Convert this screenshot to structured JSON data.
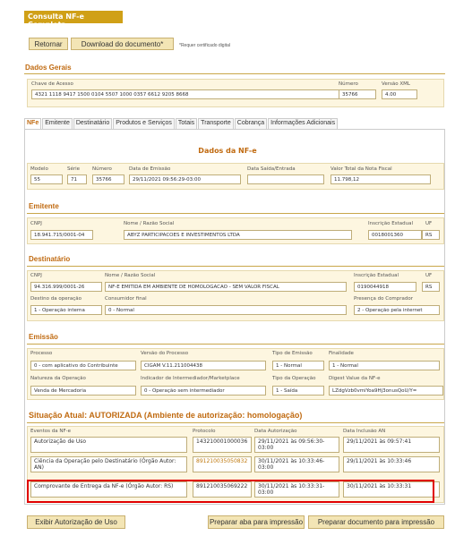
{
  "header": {
    "title": "Consulta NF-e Completa"
  },
  "actions": {
    "retornar": "Retornar",
    "download": "Download do documento*",
    "note": "*Requer certificado digital"
  },
  "dados_gerais": {
    "title": "Dados Gerais",
    "chave_label": "Chave de Acesso",
    "chave": "4321 1118 9417 1500 0104 5507 1000 0357 6612 9205 8668",
    "numero_label": "Número",
    "numero": "35766",
    "versao_label": "Versão XML",
    "versao": "4.00"
  },
  "tabs": [
    "NFe",
    "Emitente",
    "Destinatário",
    "Produtos e Serviços",
    "Totais",
    "Transporte",
    "Cobrança",
    "Informações Adicionais"
  ],
  "nfe": {
    "title": "Dados da NF-e",
    "modelo_label": "Modelo",
    "modelo": "55",
    "serie_label": "Série",
    "serie": "71",
    "numero_label": "Número",
    "numero": "35766",
    "emissao_label": "Data de Emissão",
    "emissao": "29/11/2021 09:56:29-03:00",
    "saida_label": "Data Saída/Entrada",
    "saida": "",
    "total_label": "Valor Total da Nota Fiscal",
    "total": "11.798,12"
  },
  "emitente": {
    "title": "Emitente",
    "cnpj_label": "CNPJ",
    "cnpj": "18.941.715/0001-04",
    "nome_label": "Nome / Razão Social",
    "nome": "ABYZ PARTICIPACOES E INVESTIMENTOS LTDA",
    "ie_label": "Inscrição Estadual",
    "ie": "0018001360",
    "uf_label": "UF",
    "uf": "RS"
  },
  "destinatario": {
    "title": "Destinatário",
    "cnpj_label": "CNPJ",
    "cnpj": "94.316.999/0001-26",
    "nome_label": "Nome / Razão Social",
    "nome": "NF-E EMITIDA EM AMBIENTE DE HOMOLOGACAO - SEM VALOR FISCAL",
    "ie_label": "Inscrição Estadual",
    "ie": "0190044918",
    "uf_label": "UF",
    "uf": "RS",
    "destino_label": "Destino da operação",
    "destino": "1 - Operação interna",
    "consumidor_label": "Consumidor final",
    "consumidor": "0 - Normal",
    "presenca_label": "Presença do Comprador",
    "presenca": "2 - Operação pela internet"
  },
  "emissao": {
    "title": "Emissão",
    "processo_label": "Processo",
    "processo": "0 - com aplicativo do Contribuinte",
    "versao_label": "Versão do Processo",
    "versao": "CIGAM V.11.211004438",
    "tipo_label": "Tipo de Emissão",
    "tipo": "1 - Normal",
    "finalidade_label": "Finalidade",
    "finalidade": "1 - Normal",
    "natureza_label": "Natureza da Operação",
    "natureza": "Venda de Mercadoria",
    "intermediador_label": "Indicador de Intermediador/Marketplace",
    "intermediador": "0 - Operação sem intermediador",
    "tipo_op_label": "Tipo da Operação",
    "tipo_op": "1 - Saída",
    "digest_label": "Digest Value da NF-e",
    "digest": "LZdgVzb0vmiYoa9Hj3onusQoU/Y="
  },
  "situacao": {
    "title": "Situação Atual: AUTORIZADA (Ambiente de autorização: homologação)",
    "headers": [
      "Eventos da NF-e",
      "Protocolo",
      "Data Autorização",
      "Data Inclusão AN"
    ],
    "rows": [
      {
        "evento": "Autorização de Uso",
        "protocolo": "143210001000036",
        "data_aut": "29/11/2021 às 09:56:30-03:00",
        "data_inc": "29/11/2021 às 09:57:41"
      },
      {
        "evento": "Ciência da Operação pelo Destinatário (Órgão Autor: AN)",
        "protocolo": "891210035050832",
        "data_aut": "30/11/2021 às 10:33:46-03:00",
        "data_inc": "29/11/2021 às 10:33:46"
      },
      {
        "evento": "Comprovante de Entrega da NF-e (Órgão Autor: RS)",
        "protocolo": "891210035069222",
        "data_aut": "30/11/2021 às 10:33:31-03:00",
        "data_inc": "30/11/2021 às 10:33:31"
      }
    ]
  },
  "footer": {
    "exibir": "Exibir Autorização de Uso",
    "aba": "Preparar aba para impressão",
    "documento": "Preparar documento para impressão"
  }
}
